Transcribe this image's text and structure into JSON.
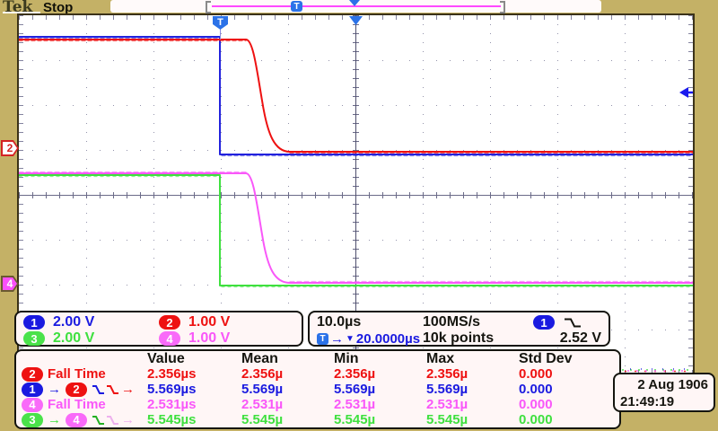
{
  "header": {
    "logo": "Tek",
    "status": "Stop"
  },
  "acq_bar": {
    "trigger_marker": "T"
  },
  "wave": {
    "trigger_flag": "T",
    "ch2_marker": "2",
    "ch4_marker": "4"
  },
  "channels": [
    {
      "num": "1",
      "scale": "2.00 V"
    },
    {
      "num": "2",
      "scale": "1.00 V"
    },
    {
      "num": "3",
      "scale": "2.00 V"
    },
    {
      "num": "4",
      "scale": "1.00 V"
    }
  ],
  "timebase": {
    "scale": "10.0µs",
    "sample_rate": "100MS/s",
    "trig_source": "1",
    "record_length": "10k points",
    "trig_prefix": "T",
    "arrow": "→",
    "cursor": "▼",
    "trig_position": "20.0000µs",
    "trig_level": "2.52 V"
  },
  "measurements": {
    "headers": [
      "Value",
      "Mean",
      "Min",
      "Max",
      "Std Dev"
    ],
    "rows": [
      {
        "source": "2",
        "label": "Fall Time",
        "values": [
          "2.356µs",
          "2.356µ",
          "2.356µ",
          "2.356µ",
          "0.000"
        ]
      },
      {
        "source": "1",
        "arrow": "→",
        "source2": "2",
        "trail_arrow": "→",
        "values": [
          "5.569µs",
          "5.569µ",
          "5.569µ",
          "5.569µ",
          "0.000"
        ]
      },
      {
        "source": "4",
        "label": "Fall Time",
        "values": [
          "2.531µs",
          "2.531µ",
          "2.531µ",
          "2.531µ",
          "0.000"
        ]
      },
      {
        "source": "3",
        "arrow": "→",
        "source2": "4",
        "trail_arrow": "→",
        "values": [
          "5.545µs",
          "5.545µ",
          "5.545µ",
          "5.545µ",
          "0.000"
        ]
      }
    ]
  },
  "datetime": {
    "date": "2 Aug 1906",
    "time": "21:49:19"
  },
  "colors": {
    "background": "#c4b166",
    "ch1": "#1a1ae0",
    "ch2": "#ee1111",
    "ch3": "#3fe03f",
    "ch4": "#f957f9",
    "trigger_blue": "#2b72e8",
    "grid": "#9494ac"
  }
}
